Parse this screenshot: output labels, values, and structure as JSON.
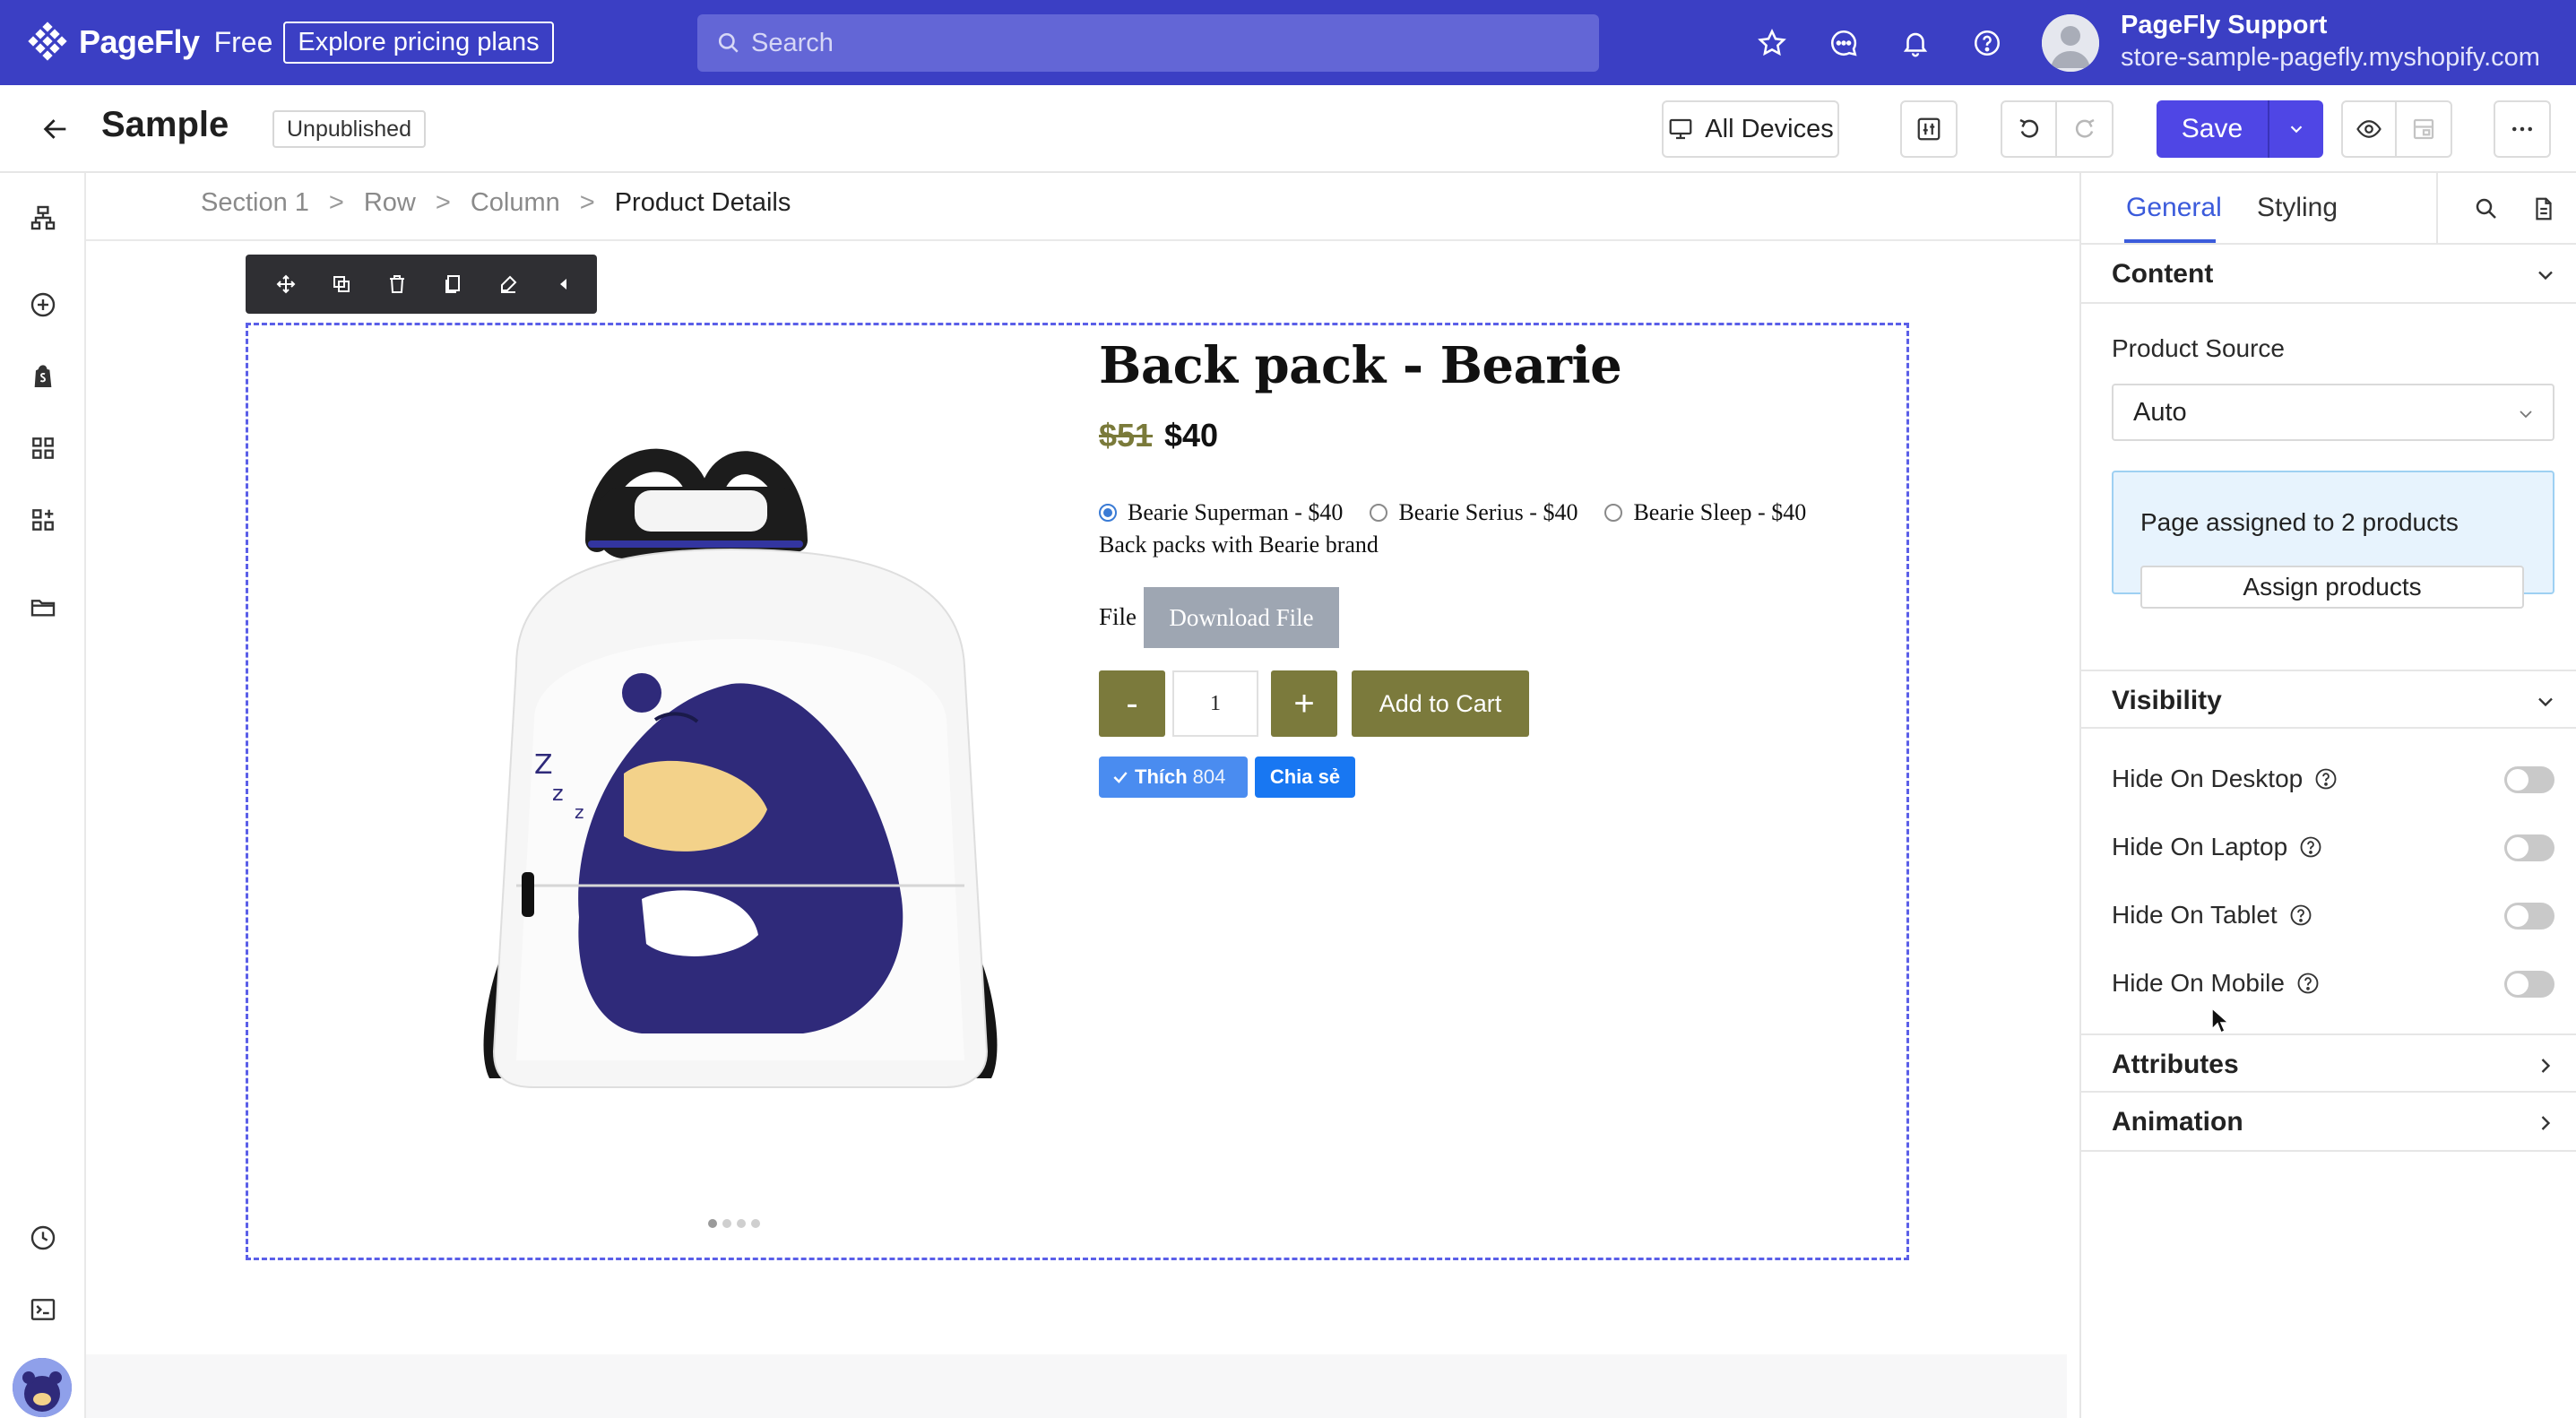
{
  "topnav": {
    "brand": "PageFly",
    "brand_suffix": "Free",
    "pricing_link": "Explore pricing plans",
    "search_placeholder": "Search",
    "user_name": "PageFly Support",
    "user_store": "store-sample-pagefly.myshopify.com",
    "icons": [
      "star-icon",
      "chat-icon",
      "bell-icon",
      "help-icon"
    ]
  },
  "toolbar": {
    "page_title": "Sample",
    "status": "Unpublished",
    "device_label": "All Devices",
    "save_label": "Save"
  },
  "breadcrumb": [
    "Section 1",
    "Row",
    "Column",
    "Product Details"
  ],
  "product": {
    "title": "Back pack - Bearie",
    "price_compare": "$51",
    "price": "$40",
    "variants": [
      {
        "label": "Bearie Superman - $40",
        "selected": true
      },
      {
        "label": "Bearie Serius - $40",
        "selected": false
      },
      {
        "label": "Bearie Sleep - $40",
        "selected": false
      }
    ],
    "description": "Back packs with Bearie brand",
    "file_label": "File",
    "download_label": "Download File",
    "qty_minus": "-",
    "qty_value": "1",
    "qty_plus": "+",
    "add_to_cart": "Add to Cart",
    "fb_like": "Thích",
    "fb_like_count": "804",
    "fb_share": "Chia sẻ",
    "accent_color": "#7b7a3c"
  },
  "panel": {
    "tabs": [
      "General",
      "Styling"
    ],
    "active_tab": "General",
    "content_section": "Content",
    "product_source_label": "Product Source",
    "product_source_value": "Auto",
    "assign_message": "Page assigned to 2 products",
    "assign_button": "Assign products",
    "visibility_section": "Visibility",
    "visibility": [
      {
        "label": "Hide On Desktop",
        "on": false
      },
      {
        "label": "Hide On Laptop",
        "on": false
      },
      {
        "label": "Hide On Tablet",
        "on": false
      },
      {
        "label": "Hide On Mobile",
        "on": false
      }
    ],
    "attributes_section": "Attributes",
    "animation_section": "Animation"
  },
  "colors": {
    "topnav": "#3b3fc4",
    "primary": "#4f46e5",
    "selection": "#5b5fe8",
    "tab_active": "#3b5bdb"
  }
}
